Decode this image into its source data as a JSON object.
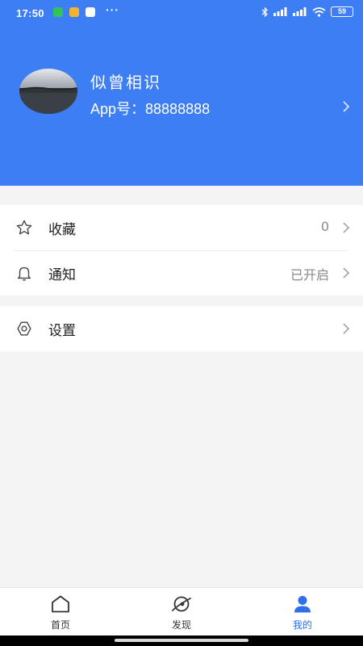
{
  "status_bar": {
    "time": "17:50",
    "dots": "···",
    "battery": "59"
  },
  "profile": {
    "name": "似曾相识",
    "app_id": "App号：88888888"
  },
  "menu": [
    {
      "label": "收藏",
      "value": "0",
      "icon": "star-icon"
    },
    {
      "label": "通知",
      "value": "已开启",
      "icon": "bell-icon"
    }
  ],
  "settings": {
    "label": "设置",
    "icon": "gear-icon"
  },
  "tabs": [
    {
      "label": "首页",
      "icon": "home-icon",
      "active": false
    },
    {
      "label": "发现",
      "icon": "discover-icon",
      "active": false
    },
    {
      "label": "我的",
      "icon": "person-icon",
      "active": true
    }
  ],
  "colors": {
    "header": "#3d7ef5",
    "active_tab": "#2f6fe8"
  }
}
